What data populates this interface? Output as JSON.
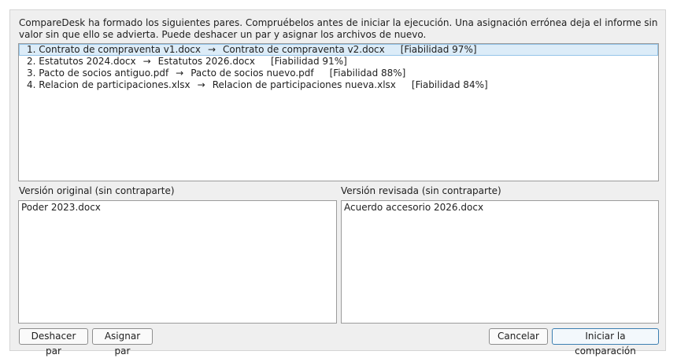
{
  "instructions": "CompareDesk ha formado los siguientes pares. Compruébelos antes de iniciar la ejecución. Una asignación errónea deja el informe sin valor sin que ello se advierta. Puede deshacer un par y asignar los archivos de nuevo.",
  "pairs": [
    {
      "index": "1.",
      "original": "Contrato de compraventa v1.docx",
      "arrow": "→",
      "revised": "Contrato de compraventa v2.docx",
      "reliability": "[Fiabilidad 97%]",
      "selected": true
    },
    {
      "index": "2.",
      "original": "Estatutos 2024.docx",
      "arrow": "→",
      "revised": "Estatutos 2026.docx",
      "reliability": "[Fiabilidad 91%]",
      "selected": false
    },
    {
      "index": "3.",
      "original": "Pacto de socios antiguo.pdf",
      "arrow": "→",
      "revised": "Pacto de socios nuevo.pdf",
      "reliability": "[Fiabilidad 88%]",
      "selected": false
    },
    {
      "index": "4.",
      "original": "Relacion de participaciones.xlsx",
      "arrow": "→",
      "revised": "Relacion de participaciones nueva.xlsx",
      "reliability": "[Fiabilidad 84%]",
      "selected": false
    }
  ],
  "unmatched_original": {
    "label": "Versión original (sin contraparte)",
    "files": [
      "Poder 2023.docx"
    ]
  },
  "unmatched_revised": {
    "label": "Versión revisada (sin contraparte)",
    "files": [
      "Acuerdo accesorio 2026.docx"
    ]
  },
  "buttons": {
    "undo_pair": "Deshacer par",
    "assign_pair": "Asignar par",
    "cancel": "Cancelar",
    "start": "Iniciar la comparación"
  },
  "colors": {
    "selection_bg": "#dcecf8",
    "selection_border": "#94c4e8",
    "primary_border": "#3c7fb1"
  }
}
